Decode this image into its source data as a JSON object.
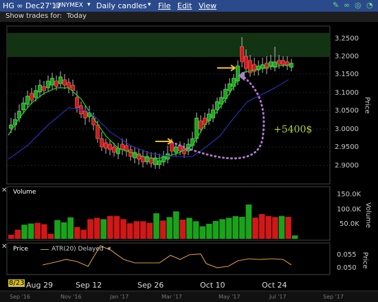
{
  "titlebar": {
    "symbol": "HG ∞ Dec27'17",
    "exchange": "@NYMEX",
    "period": "Daily candles",
    "menu_file": "File",
    "menu_edit": "Edit",
    "menu_view": "View"
  },
  "toolbar": {
    "show_trades_label": "Show trades for:",
    "show_trades_value": "Today"
  },
  "price_pane": {
    "axis_label": "Price",
    "ticks": [
      "3.2500",
      "3.2000",
      "3.1500",
      "3.1000",
      "3.0500",
      "3.0000",
      "2.9500",
      "2.9000"
    ],
    "annotation": "+5400$"
  },
  "volume_pane": {
    "title": "Volume",
    "axis_label": "Volume",
    "ticks": [
      "150.0K",
      "100.0K",
      "50.0K"
    ],
    "bars": [
      {
        "v": 18,
        "c": "red"
      },
      {
        "v": 40,
        "c": "red"
      },
      {
        "v": 62,
        "c": "green"
      },
      {
        "v": 67,
        "c": "green"
      },
      {
        "v": 70,
        "c": "red"
      },
      {
        "v": 64,
        "c": "red"
      },
      {
        "v": 22,
        "c": "red"
      },
      {
        "v": 82,
        "c": "green"
      },
      {
        "v": 72,
        "c": "green"
      },
      {
        "v": 94,
        "c": "green"
      },
      {
        "v": 52,
        "c": "red"
      },
      {
        "v": 40,
        "c": "red"
      },
      {
        "v": 86,
        "c": "red"
      },
      {
        "v": 92,
        "c": "red"
      },
      {
        "v": 86,
        "c": "green"
      },
      {
        "v": 100,
        "c": "red"
      },
      {
        "v": 100,
        "c": "red"
      },
      {
        "v": 86,
        "c": "red"
      },
      {
        "v": 68,
        "c": "red"
      },
      {
        "v": 77,
        "c": "red"
      },
      {
        "v": 77,
        "c": "red"
      },
      {
        "v": 70,
        "c": "red"
      },
      {
        "v": 112,
        "c": "green"
      },
      {
        "v": 80,
        "c": "red"
      },
      {
        "v": 95,
        "c": "green"
      },
      {
        "v": 120,
        "c": "green"
      },
      {
        "v": 84,
        "c": "red"
      },
      {
        "v": 92,
        "c": "green"
      },
      {
        "v": 77,
        "c": "green"
      },
      {
        "v": 55,
        "c": "green"
      },
      {
        "v": 66,
        "c": "green"
      },
      {
        "v": 78,
        "c": "green"
      },
      {
        "v": 86,
        "c": "green"
      },
      {
        "v": 92,
        "c": "green"
      },
      {
        "v": 99,
        "c": "green"
      },
      {
        "v": 96,
        "c": "green"
      },
      {
        "v": 150,
        "c": "green"
      },
      {
        "v": 93,
        "c": "red"
      },
      {
        "v": 108,
        "c": "red"
      },
      {
        "v": 100,
        "c": "red"
      },
      {
        "v": 95,
        "c": "red"
      },
      {
        "v": 100,
        "c": "green"
      },
      {
        "v": 96,
        "c": "red"
      },
      {
        "v": 15,
        "c": "green"
      }
    ]
  },
  "atr_pane": {
    "title": "Price",
    "legend": "ATR(20) Delayed",
    "axis_label": "Price",
    "ticks": [
      "0.055",
      "0.050"
    ]
  },
  "date_axis": {
    "current": "8/23",
    "labels": [
      "Aug 29",
      "Sep 12",
      "Sep 26",
      "Oct 10",
      "Oct 24"
    ]
  },
  "overview_axis": {
    "labels": [
      "Sep '16",
      "Nov '16",
      "Jan '17",
      "Mar '17",
      "May '17",
      "Jul '17",
      "Sep '17"
    ]
  },
  "colors": {
    "up": "#1aa31a",
    "down": "#d01818",
    "ma_fast": "#22cc22",
    "ma_slow": "#2a2aa8",
    "atr": "#d99a3a",
    "annotation": "#b07ad0",
    "profit_text": "#b0d040",
    "arrow": "#f0c020"
  }
}
